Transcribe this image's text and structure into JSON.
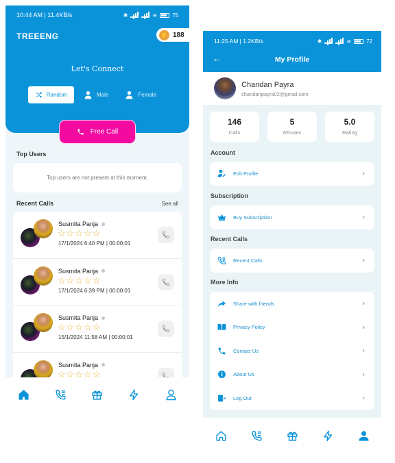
{
  "colors": {
    "primary": "#0b93d9",
    "accent": "#f20aa1",
    "star": "#eab23a",
    "coin": "#eba43a"
  },
  "left": {
    "status": {
      "time": "10:44 AM | 11.4KB/s",
      "battery": "75"
    },
    "brand": "TREEENG",
    "coins": "188",
    "connect_title": "Let's Connect",
    "gender_options": [
      {
        "label": "Random",
        "icon": "shuffle-icon",
        "active": true
      },
      {
        "label": "Male",
        "icon": "person-icon",
        "active": false
      },
      {
        "label": "Female",
        "icon": "person-icon",
        "active": false
      }
    ],
    "free_call": "Free Call",
    "top_users": {
      "title": "Top Users",
      "empty_text": "Top users are not present at this moment."
    },
    "recent_calls": {
      "title": "Recent Calls",
      "see_all": "See all",
      "items": [
        {
          "name": "Susmita Panja",
          "rating": 0,
          "date": "17/1/2024",
          "time": "6:40 PM",
          "duration": "00:00:01"
        },
        {
          "name": "Susmita Panja",
          "rating": 0,
          "date": "17/1/2024",
          "time": "6:39 PM",
          "duration": "00:00:01"
        },
        {
          "name": "Susmita Panja",
          "rating": 0,
          "date": "15/1/2024",
          "time": "11:58 AM",
          "duration": "00:00:01"
        },
        {
          "name": "Susmita Panja",
          "rating": 0,
          "date": "",
          "time": "",
          "duration": ""
        }
      ]
    },
    "nav": [
      "home-icon",
      "call-log-icon",
      "gift-icon",
      "bolt-icon",
      "user-icon"
    ],
    "nav_active": 0
  },
  "right": {
    "status": {
      "time": "11:25 AM | 1.2KB/s",
      "battery": "72"
    },
    "title": "My Profile",
    "profile": {
      "name": "Chandan Payra",
      "email": "chandanpayra02@gmail.com"
    },
    "stats": [
      {
        "value": "146",
        "label": "Calls"
      },
      {
        "value": "5",
        "label": "Minutes"
      },
      {
        "value": "5.0",
        "label": "Rating"
      }
    ],
    "sections": {
      "account": {
        "title": "Account",
        "items": [
          {
            "label": "Edit Profile",
            "icon": "edit-user-icon"
          }
        ]
      },
      "subscription": {
        "title": "Subscription",
        "items": [
          {
            "label": "Buy Subscription",
            "icon": "crown-icon"
          }
        ]
      },
      "recent_calls": {
        "title": "Recent Calls",
        "items": [
          {
            "label": "Recent Calls",
            "icon": "call-log-icon"
          }
        ]
      },
      "more_info": {
        "title": "More Info",
        "items": [
          {
            "label": "Share with friends",
            "icon": "share-icon"
          },
          {
            "label": "Privacy Policy",
            "icon": "book-icon"
          },
          {
            "label": "Contact Us",
            "icon": "phone-icon"
          },
          {
            "label": "About Us",
            "icon": "info-icon"
          },
          {
            "label": "Log Out",
            "icon": "logout-icon"
          }
        ]
      }
    },
    "nav": [
      "home-icon",
      "call-log-icon",
      "gift-icon",
      "bolt-icon",
      "user-icon"
    ],
    "nav_active": 4
  }
}
